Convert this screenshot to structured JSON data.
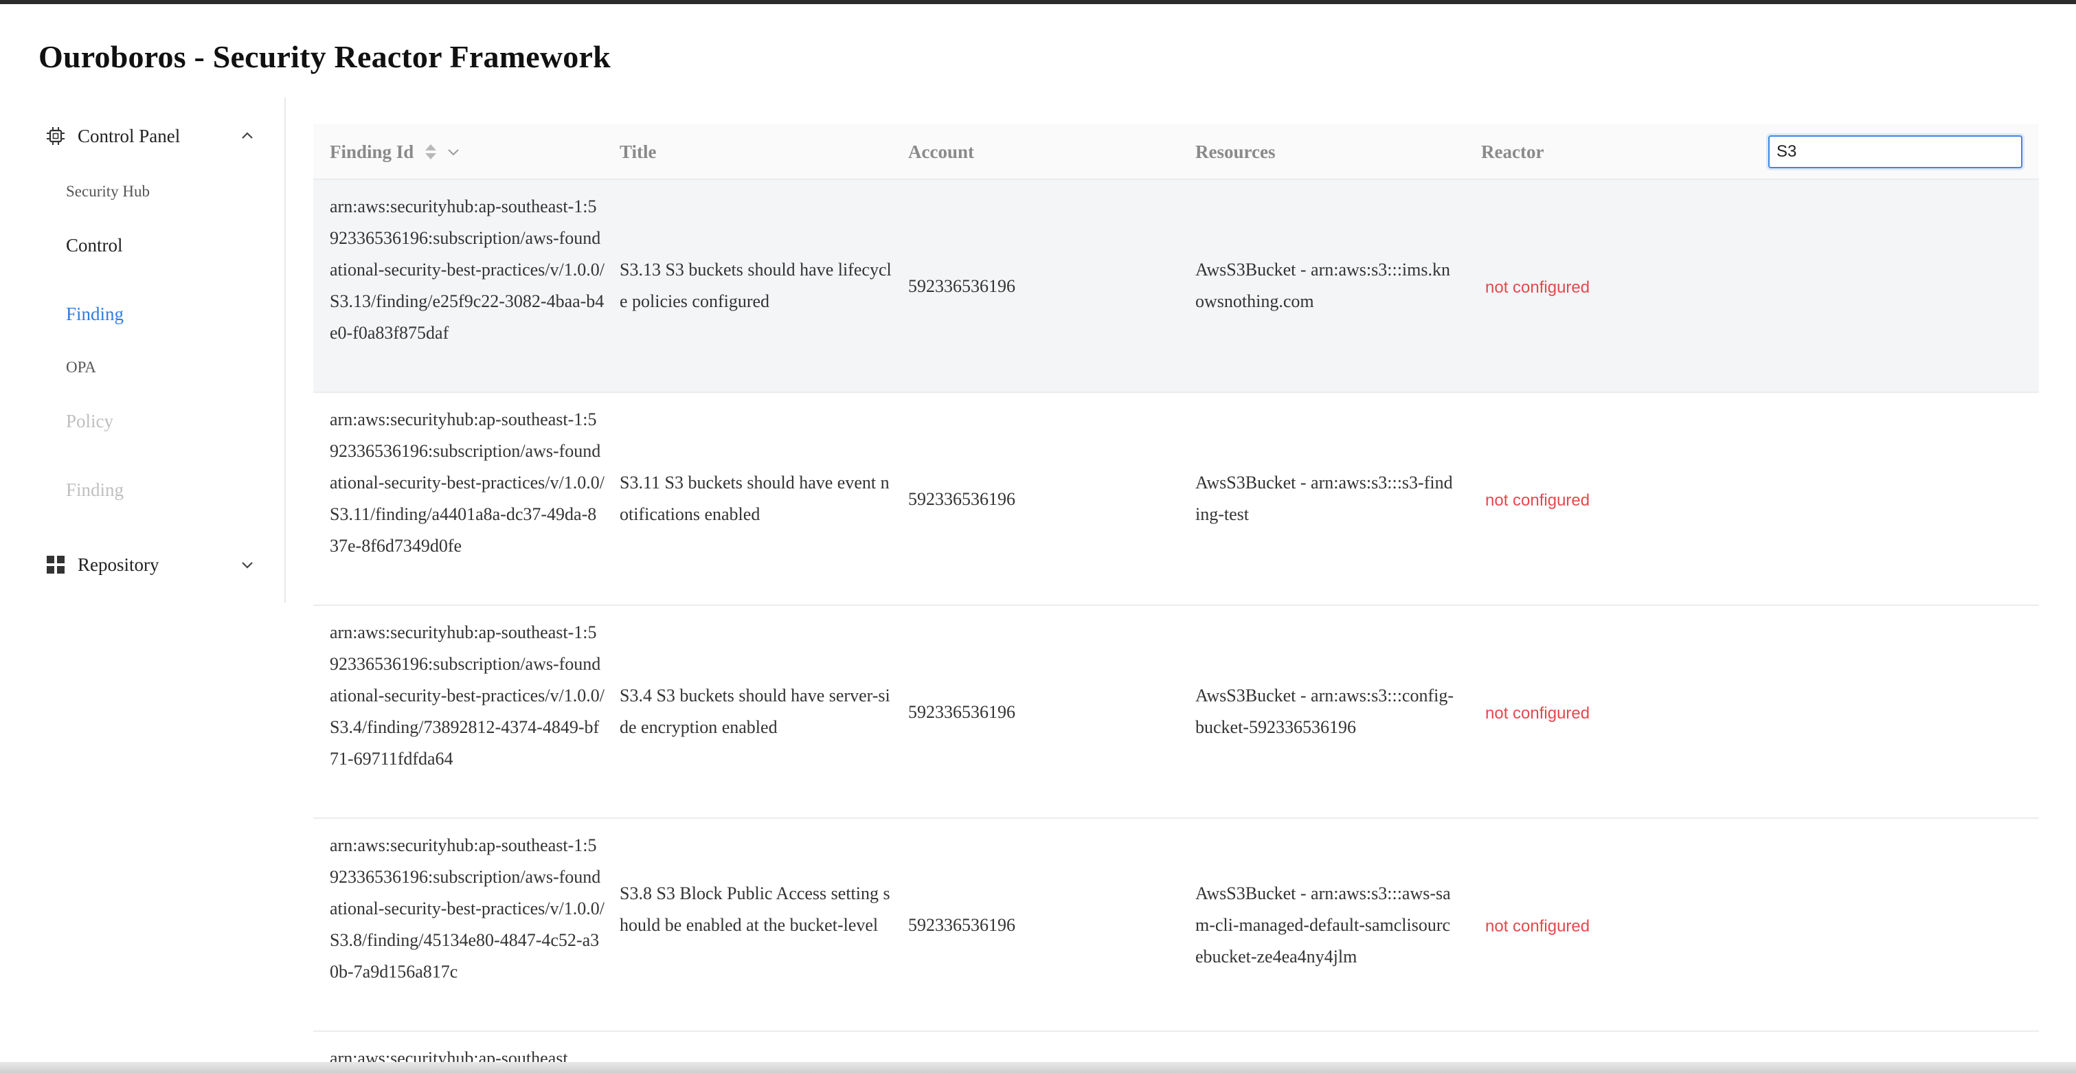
{
  "app": {
    "title": "Ouroboros - Security Reactor Framework"
  },
  "sidebar": {
    "control_panel": {
      "label": "Control Panel",
      "icon": "chip-icon"
    },
    "items": [
      {
        "label": "Security Hub"
      },
      {
        "label": "Control"
      },
      {
        "label": "Finding"
      },
      {
        "label": "OPA"
      },
      {
        "label": "Policy"
      },
      {
        "label": "Finding"
      }
    ],
    "repository": {
      "label": "Repository",
      "icon": "grid-icon"
    }
  },
  "table": {
    "columns": [
      "Finding Id",
      "Title",
      "Account",
      "Resources",
      "Reactor"
    ],
    "search": {
      "value": "S3"
    },
    "rows": [
      {
        "id": "arn:aws:securityhub:ap-southeast-1:592336536196:subscription/aws-foundational-security-best-practices/v/1.0.0/S3.13/finding/e25f9c22-3082-4baa-b4e0-f0a83f875daf",
        "title": "S3.13 S3 buckets should have lifecycle policies configured",
        "account": "592336536196",
        "resources": "AwsS3Bucket - arn:aws:s3:::ims.knowsnothing.com",
        "reactor": "not configured"
      },
      {
        "id": "arn:aws:securityhub:ap-southeast-1:592336536196:subscription/aws-foundational-security-best-practices/v/1.0.0/S3.11/finding/a4401a8a-dc37-49da-837e-8f6d7349d0fe",
        "title": "S3.11 S3 buckets should have event notifications enabled",
        "account": "592336536196",
        "resources": "AwsS3Bucket - arn:aws:s3:::s3-finding-test",
        "reactor": "not configured"
      },
      {
        "id": "arn:aws:securityhub:ap-southeast-1:592336536196:subscription/aws-foundational-security-best-practices/v/1.0.0/S3.4/finding/73892812-4374-4849-bf71-69711fdfda64",
        "title": "S3.4 S3 buckets should have server-side encryption enabled",
        "account": "592336536196",
        "resources": "AwsS3Bucket - arn:aws:s3:::config-bucket-592336536196",
        "reactor": "not configured"
      },
      {
        "id": "arn:aws:securityhub:ap-southeast-1:592336536196:subscription/aws-foundational-security-best-practices/v/1.0.0/S3.8/finding/45134e80-4847-4c52-a30b-7a9d156a817c",
        "title": "S3.8 S3 Block Public Access setting should be enabled at the bucket-level",
        "account": "592336536196",
        "resources": "AwsS3Bucket - arn:aws:s3:::aws-sam-cli-managed-default-samclisourcebucket-ze4ea4ny4jlm",
        "reactor": "not configured"
      },
      {
        "id": "arn:aws:securityhub:ap-southeast",
        "title": "",
        "account": "",
        "resources": "",
        "reactor": ""
      }
    ]
  },
  "colors": {
    "accent": "#2f7de1",
    "reactor_status": "#e5484d",
    "title": "#111111"
  }
}
